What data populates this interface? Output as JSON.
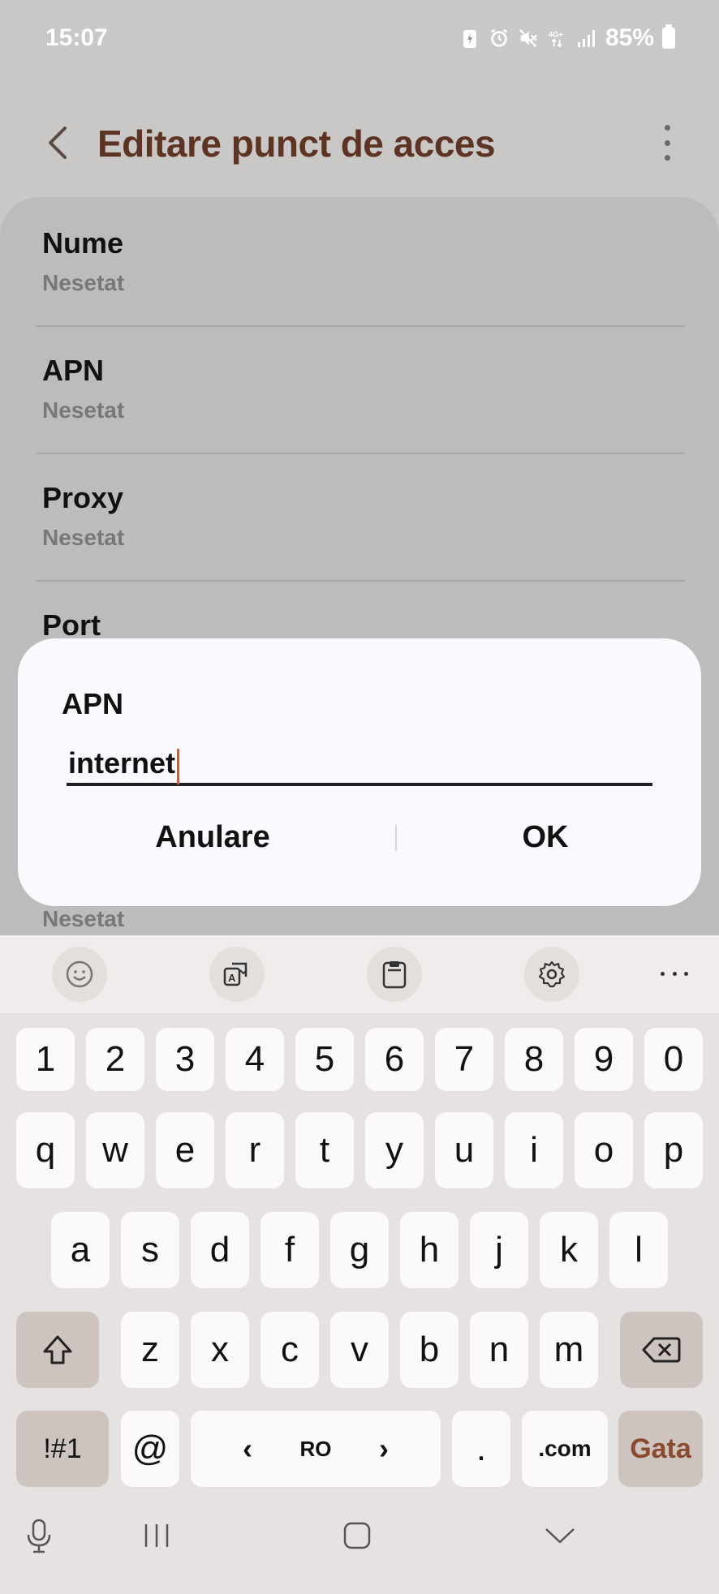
{
  "status_bar": {
    "time": "15:07",
    "battery": "85%",
    "icons": [
      "battery-saver-icon",
      "alarm-icon",
      "mute-icon",
      "4g-data-icon",
      "signal-icon",
      "battery-icon"
    ]
  },
  "header": {
    "title": "Editare punct de acces",
    "back_icon": "chevron-left-icon",
    "menu_icon": "more-vertical-icon"
  },
  "settings": {
    "items": [
      {
        "label": "Nume",
        "value": "Nesetat"
      },
      {
        "label": "APN",
        "value": "Nesetat"
      },
      {
        "label": "Proxy",
        "value": "Nesetat"
      },
      {
        "label": "Port",
        "value": ""
      }
    ],
    "partial_value": "Nesetat"
  },
  "dialog": {
    "title": "APN",
    "input_value": "internet",
    "cancel_label": "Anulare",
    "ok_label": "OK"
  },
  "keyboard": {
    "toolbar_icons": [
      "emoji-icon",
      "translate-icon",
      "clipboard-icon",
      "settings-icon",
      "more-horizontal-icon"
    ],
    "row_numbers": [
      "1",
      "2",
      "3",
      "4",
      "5",
      "6",
      "7",
      "8",
      "9",
      "0"
    ],
    "row_top": [
      "q",
      "w",
      "e",
      "r",
      "t",
      "y",
      "u",
      "i",
      "o",
      "p"
    ],
    "row_mid": [
      "a",
      "s",
      "d",
      "f",
      "g",
      "h",
      "j",
      "k",
      "l"
    ],
    "row_bottom": [
      "z",
      "x",
      "c",
      "v",
      "b",
      "n",
      "m"
    ],
    "symbols_label": "!#1",
    "at_label": "@",
    "language": "RO",
    "lang_prev": "‹",
    "lang_next": "›",
    "period_label": ".",
    "dotcom_label": ".com",
    "done_label": "Gata"
  },
  "nav_bar": {
    "icons": [
      "microphone-icon",
      "recent-apps-icon",
      "home-icon",
      "hide-keyboard-icon"
    ]
  },
  "colors": {
    "title": "#5d3423",
    "accent": "#8a4a30",
    "caret": "#b4654a"
  }
}
